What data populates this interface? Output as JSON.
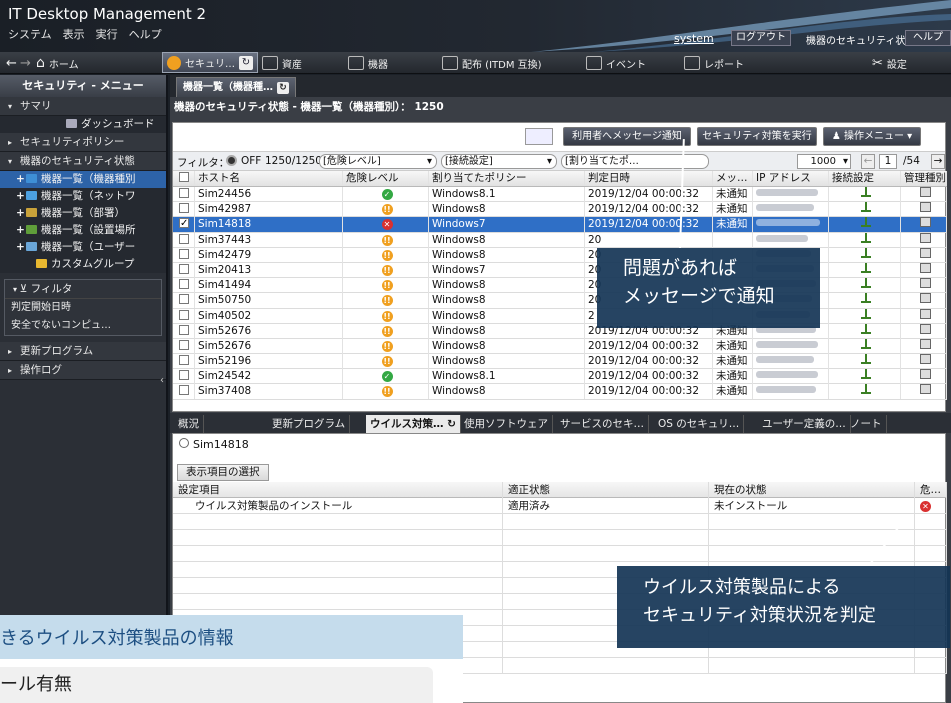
{
  "app": {
    "title": "IT Desktop Management 2",
    "menu": [
      "システム",
      "表示",
      "実行",
      "ヘルプ"
    ],
    "user": "system",
    "logout_label": "ログアウト",
    "context_label": "機器のセキュリティ状態",
    "help_label": "ヘルプ"
  },
  "nav": {
    "home": "ホーム",
    "security": "セキュリ…",
    "assets": "資産",
    "devices": "機器",
    "distribution": "配布 (ITDM 互換)",
    "events": "イベント",
    "reports": "レポート",
    "settings": "設定"
  },
  "sidebar": {
    "header": "セキュリティ - メニュー",
    "items": [
      {
        "label": "サマリ"
      },
      {
        "label": "ダッシュボード"
      },
      {
        "label": "セキュリティポリシー"
      },
      {
        "label": "機器のセキュリティ状態"
      }
    ],
    "subitems": [
      {
        "label": "機器一覧（機器種別",
        "color": "#3e8fd6"
      },
      {
        "label": "機器一覧（ネットワ",
        "color": "#4ca0e0"
      },
      {
        "label": "機器一覧（部署）",
        "color": "#c9a23a"
      },
      {
        "label": "機器一覧（設置場所",
        "color": "#5f9e3a"
      },
      {
        "label": "機器一覧（ユーザー",
        "color": "#6aa6d8"
      },
      {
        "label": "カスタムグループ",
        "color": "#e8b830"
      }
    ],
    "filter_title": "フィルタ",
    "filter_rows": [
      "判定開始日時",
      "安全でないコンピュ…"
    ],
    "bottom_items": [
      {
        "label": "更新プログラム"
      },
      {
        "label": "操作ログ"
      }
    ]
  },
  "main": {
    "tab_label": "機器一覧（機器種…",
    "context_title": "機器のセキュリティ状態 - 機器一覧（機器種別）： 1250",
    "toolbar": {
      "notify_label": "利用者へメッセージ通知",
      "security_action_label": "セキュリティ対策を実行",
      "ops_menu_label": "操作メニュー"
    },
    "filter": {
      "label": "フィルタ：",
      "status": "OFF",
      "count": "1250/1250",
      "dd1": "[危険レベル]",
      "dd2": "[接続設定]",
      "dd3": "[割り当てたポ…",
      "page_size": "1000",
      "page": "1",
      "pages": "/54"
    }
  },
  "grid": {
    "columns": [
      "ホスト名",
      "危険レベル",
      "割り当てたポリシー",
      "判定日時",
      "メッ…",
      "IP アドレス",
      "接続設定",
      "管理種別"
    ],
    "rows": [
      {
        "host": "Sim24456",
        "risk": "ok",
        "policy": "Windows8.1",
        "date": "2019/12/04 00:00:32",
        "msg": "未通知",
        "selected": false
      },
      {
        "host": "Sim42987",
        "risk": "warn",
        "policy": "Windows8",
        "date": "2019/12/04 00:00:32",
        "msg": "未通知",
        "selected": false
      },
      {
        "host": "Sim14818",
        "risk": "bad",
        "policy": "Windows7",
        "date": "2019/12/04 00:00:32",
        "msg": "未通知",
        "selected": true
      },
      {
        "host": "Sim37443",
        "risk": "warn",
        "policy": "Windows8",
        "date": "20",
        "msg": "",
        "selected": false
      },
      {
        "host": "Sim42479",
        "risk": "warn",
        "policy": "Windows8",
        "date": "20",
        "msg": "",
        "selected": false
      },
      {
        "host": "Sim20413",
        "risk": "warn",
        "policy": "Windows7",
        "date": "20",
        "msg": "",
        "selected": false
      },
      {
        "host": "Sim41494",
        "risk": "warn",
        "policy": "Windows8",
        "date": "20",
        "msg": "",
        "selected": false
      },
      {
        "host": "Sim50750",
        "risk": "warn",
        "policy": "Windows8",
        "date": "20",
        "msg": "",
        "selected": false
      },
      {
        "host": "Sim40502",
        "risk": "warn",
        "policy": "Windows8",
        "date": "2",
        "msg": "",
        "selected": false
      },
      {
        "host": "Sim52676",
        "risk": "warn",
        "policy": "Windows8",
        "date": "2019/12/04 00:00:32",
        "msg": "未通知",
        "selected": false
      },
      {
        "host": "Sim52676",
        "risk": "warn",
        "policy": "Windows8",
        "date": "2019/12/04 00:00:32",
        "msg": "未通知",
        "selected": false
      },
      {
        "host": "Sim52196",
        "risk": "warn",
        "policy": "Windows8",
        "date": "2019/12/04 00:00:32",
        "msg": "未通知",
        "selected": false
      },
      {
        "host": "Sim24542",
        "risk": "ok",
        "policy": "Windows8.1",
        "date": "2019/12/04 00:00:32",
        "msg": "未通知",
        "selected": false
      },
      {
        "host": "Sim37408",
        "risk": "warn",
        "policy": "Windows8",
        "date": "2019/12/04 00:00:32",
        "msg": "未通知",
        "selected": false
      }
    ]
  },
  "detail_tabs": [
    "概況",
    "更新プログラム",
    "ウイルス対策…",
    "使用ソフトウェア",
    "サービスのセキ…",
    "OS のセキュリ…",
    "ユーザー定義の…",
    "ノート"
  ],
  "detail": {
    "device_name": "Sim14818",
    "select_columns_label": "表示項目の選択",
    "columns": [
      "設定項目",
      "適正状態",
      "現在の状態",
      "危…"
    ],
    "rows": [
      {
        "item": "ウイルス対策製品のインストール",
        "proper": "適用済み",
        "current": "未インストール",
        "risk": "bad"
      }
    ]
  },
  "callouts": {
    "notify": [
      "問題があれば",
      "メッセージで通知"
    ],
    "judge": [
      "ウイルス対策製品による",
      "セキュリティ対策状況を判定"
    ]
  },
  "overlay": {
    "header": "きるウイルス対策製品の情報",
    "item": "ール有無"
  },
  "colors": {
    "selected_row": "#2f6fc6",
    "callout_bg": "#143455",
    "risk_ok": "#33a843",
    "risk_warn": "#f0a020",
    "risk_bad": "#d93030"
  }
}
